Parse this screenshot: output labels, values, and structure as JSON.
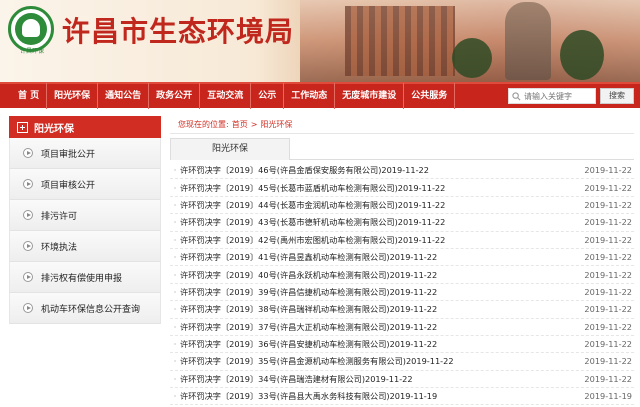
{
  "header": {
    "site_title": "许昌市生态环境局",
    "logo_caption": "许昌环保"
  },
  "nav": {
    "items": [
      "首 页",
      "阳光环保",
      "通知公告",
      "政务公开",
      "互动交流",
      "公示",
      "工作动态",
      "无废城市建设",
      "公共服务"
    ],
    "search_placeholder": "请输入关键字",
    "search_button": "搜索"
  },
  "sidebar": {
    "heading": "阳光环保",
    "items": [
      "项目审批公开",
      "项目审核公开",
      "排污许可",
      "环境执法",
      "排污权有偿使用申报",
      "机动车环保信息公开查询"
    ]
  },
  "breadcrumb": {
    "prefix": "您现在的位置:",
    "home": "首页",
    "sep": ">",
    "current": "阳光环保"
  },
  "tab": {
    "label": "阳光环保"
  },
  "list": [
    {
      "title": "许环罚决字〔2019〕46号(许昌金盾保安服务有限公司)2019-11-22",
      "date": "2019-11-22"
    },
    {
      "title": "许环罚决字〔2019〕45号(长葛市蓝盾机动车检测有限公司)2019-11-22",
      "date": "2019-11-22"
    },
    {
      "title": "许环罚决字〔2019〕44号(长葛市金润机动车检测有限公司)2019-11-22",
      "date": "2019-11-22"
    },
    {
      "title": "许环罚决字〔2019〕43号(长葛市德轩机动车检测有限公司)2019-11-22",
      "date": "2019-11-22"
    },
    {
      "title": "许环罚决字〔2019〕42号(禹州市宏图机动车检测有限公司)2019-11-22",
      "date": "2019-11-22"
    },
    {
      "title": "许环罚决字〔2019〕41号(许昌昱鑫机动车检测有限公司)2019-11-22",
      "date": "2019-11-22"
    },
    {
      "title": "许环罚决字〔2019〕40号(许昌永跃机动车检测有限公司)2019-11-22",
      "date": "2019-11-22"
    },
    {
      "title": "许环罚决字〔2019〕39号(许昌信捷机动车检测有限公司)2019-11-22",
      "date": "2019-11-22"
    },
    {
      "title": "许环罚决字〔2019〕38号(许昌瑞祥机动车检测有限公司)2019-11-22",
      "date": "2019-11-22"
    },
    {
      "title": "许环罚决字〔2019〕37号(许昌大正机动车检测有限公司)2019-11-22",
      "date": "2019-11-22"
    },
    {
      "title": "许环罚决字〔2019〕36号(许昌安捷机动车检测有限公司)2019-11-22",
      "date": "2019-11-22"
    },
    {
      "title": "许环罚决字〔2019〕35号(许昌金源机动车检测服务有限公司)2019-11-22",
      "date": "2019-11-22"
    },
    {
      "title": "许环罚决字〔2019〕34号(许昌瑞浩建材有限公司)2019-11-22",
      "date": "2019-11-22"
    },
    {
      "title": "许环罚决字〔2019〕33号(许昌县大禹水务科技有限公司)2019-11-19",
      "date": "2019-11-19"
    }
  ]
}
